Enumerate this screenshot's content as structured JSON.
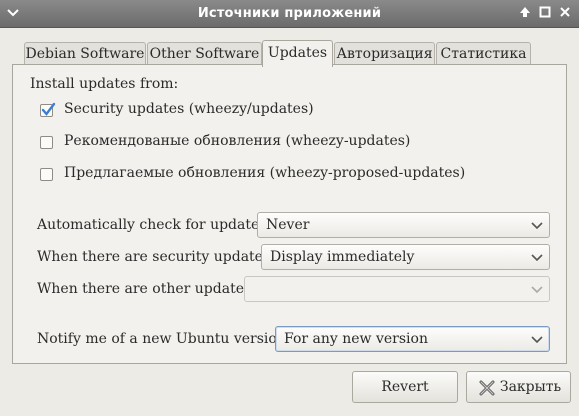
{
  "window": {
    "title": "Источники приложений",
    "controls": {
      "up": "🡅",
      "maximize": "☐",
      "close": "✕"
    }
  },
  "tabs": [
    {
      "label": "Debian Software"
    },
    {
      "label": "Other Software"
    },
    {
      "label": "Updates",
      "active": true
    },
    {
      "label": "Авторизация"
    },
    {
      "label": "Статистика"
    }
  ],
  "install_updates": {
    "label": "Install updates from:",
    "options": [
      {
        "label": "Security updates (wheezy/updates)",
        "checked": true
      },
      {
        "label": "Рекомендованые обновления (wheezy-updates)",
        "checked": false
      },
      {
        "label": "Предлагаемые обновления (wheezy-proposed-updates)",
        "checked": false
      }
    ]
  },
  "settings": {
    "auto_check": {
      "label": "Automatically check for updates:",
      "value": "Never"
    },
    "security_updates": {
      "label": "When there are security updates:",
      "value": "Display immediately"
    },
    "other_updates": {
      "label": "When there are other updates:",
      "value": ""
    },
    "notify": {
      "label": "Notify me of a new Ubuntu version:",
      "value": "For any new version"
    }
  },
  "buttons": {
    "revert": "Revert",
    "close": "Закрыть"
  },
  "icons": {
    "menu": "menu-icon",
    "check": "checkmark-icon",
    "combo": "chevron-down-icon",
    "close": "close-icon"
  },
  "colors": {
    "titlebar": "#7a7a7a",
    "check": "#3b7fd4",
    "focus": "#7a9cc2"
  }
}
